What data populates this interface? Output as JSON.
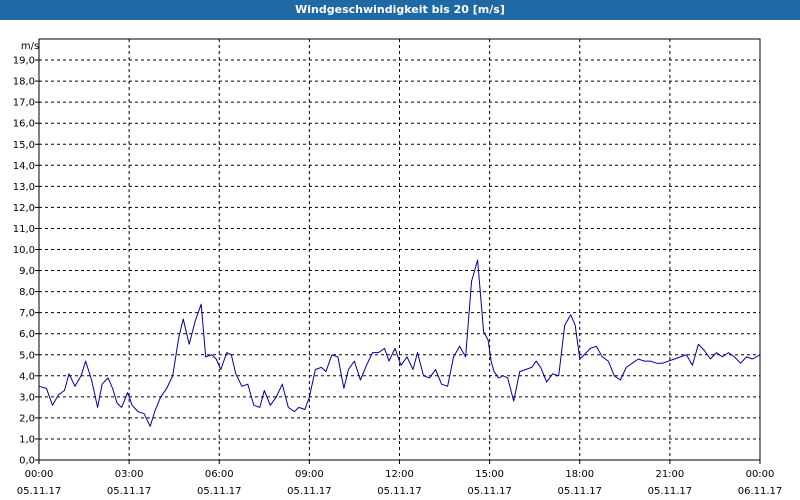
{
  "window": {
    "title": "Windgeschwindigkeit bis 20 [m/s]"
  },
  "colors": {
    "titlebar": "#1f6aa5",
    "line": "#0000aa",
    "grid": "#000000",
    "background": "#ffffff"
  },
  "chart_data": {
    "type": "line",
    "title": "Windgeschwindigkeit bis 20 [m/s]",
    "ylabel": "m/s",
    "xlabel": "",
    "ylim": [
      0,
      20
    ],
    "y_ticks": [
      "0,0",
      "1,0",
      "2,0",
      "3,0",
      "4,0",
      "5,0",
      "6,0",
      "7,0",
      "8,0",
      "9,0",
      "10,0",
      "11,0",
      "12,0",
      "13,0",
      "14,0",
      "15,0",
      "16,0",
      "17,0",
      "18,0",
      "19,0"
    ],
    "x_ticks": [
      {
        "time": "00:00",
        "date": "05.11.17"
      },
      {
        "time": "03:00",
        "date": "05.11.17"
      },
      {
        "time": "06:00",
        "date": "05.11.17"
      },
      {
        "time": "09:00",
        "date": "05.11.17"
      },
      {
        "time": "12:00",
        "date": "05.11.17"
      },
      {
        "time": "15:00",
        "date": "05.11.17"
      },
      {
        "time": "18:00",
        "date": "05.11.17"
      },
      {
        "time": "21:00",
        "date": "05.11.17"
      },
      {
        "time": "00:00",
        "date": "06.11.17"
      }
    ],
    "grid": true,
    "x_unit": "hours",
    "xlim": [
      0,
      24
    ],
    "series": [
      {
        "x": [
          0,
          0.25,
          0.45,
          0.65,
          0.85,
          1.0,
          1.2,
          1.4,
          1.55,
          1.75,
          1.95,
          2.1,
          2.3,
          2.45,
          2.6,
          2.75,
          2.95,
          3.1,
          3.3,
          3.5,
          3.7,
          3.85,
          4.05,
          4.25,
          4.45,
          4.65,
          4.8,
          5.0,
          5.2,
          5.4,
          5.55,
          5.75,
          5.9,
          6.05,
          6.25,
          6.4,
          6.55,
          6.75,
          6.95,
          7.15,
          7.35,
          7.5,
          7.7,
          7.9,
          8.1,
          8.3,
          8.5,
          8.65,
          8.85,
          9.0,
          9.2,
          9.4,
          9.55,
          9.75,
          9.95,
          10.15,
          10.3,
          10.5,
          10.7,
          10.9,
          11.1,
          11.3,
          11.5,
          11.65,
          11.85,
          12.05,
          12.25,
          12.45,
          12.6,
          12.8,
          13.0,
          13.2,
          13.4,
          13.6,
          13.8,
          14.0,
          14.2,
          14.4,
          14.6,
          14.8,
          14.95,
          15.05,
          15.15,
          15.3,
          15.45,
          15.6,
          15.8,
          16.0,
          16.2,
          16.4,
          16.55,
          16.7,
          16.9,
          17.1,
          17.3,
          17.5,
          17.7,
          17.85,
          18.0,
          18.15,
          18.35,
          18.55,
          18.75,
          18.95,
          19.15,
          19.35,
          19.55,
          19.75,
          19.95,
          20.15,
          20.35,
          20.55,
          20.75,
          20.95,
          21.15,
          21.35,
          21.55,
          21.75,
          21.95,
          22.15,
          22.35,
          22.55,
          22.75,
          22.95,
          23.15,
          23.35,
          23.55,
          23.75,
          24.0
        ],
        "values": [
          3.5,
          3.4,
          2.6,
          3.1,
          3.3,
          4.1,
          3.5,
          4.0,
          4.7,
          3.8,
          2.5,
          3.6,
          3.9,
          3.4,
          2.7,
          2.5,
          3.2,
          2.6,
          2.3,
          2.2,
          1.6,
          2.3,
          3.0,
          3.4,
          4.0,
          5.8,
          6.7,
          5.5,
          6.6,
          7.4,
          4.9,
          5.0,
          4.8,
          4.3,
          5.1,
          5.0,
          4.1,
          3.5,
          3.6,
          2.6,
          2.5,
          3.3,
          2.6,
          3.0,
          3.6,
          2.5,
          2.3,
          2.5,
          2.4,
          3.0,
          4.3,
          4.4,
          4.2,
          5.0,
          4.9,
          3.4,
          4.3,
          4.7,
          3.8,
          4.5,
          5.1,
          5.1,
          5.3,
          4.7,
          5.3,
          4.5,
          4.9,
          4.3,
          5.1,
          4.0,
          3.9,
          4.3,
          3.6,
          3.5,
          4.9,
          5.4,
          4.9,
          8.5,
          9.5,
          6.1,
          5.7,
          4.7,
          4.2,
          3.9,
          4.0,
          3.9,
          2.8,
          4.2,
          4.3,
          4.4,
          4.7,
          4.4,
          3.7,
          4.1,
          4.0,
          6.4,
          6.9,
          6.4,
          4.8,
          5.0,
          5.3,
          5.4,
          4.9,
          4.7,
          4.0,
          3.8,
          4.4,
          4.6,
          4.8,
          4.7,
          4.7,
          4.6,
          4.6,
          4.7,
          4.8,
          4.9,
          5.0,
          4.5,
          5.5,
          5.2,
          4.8,
          5.1,
          4.9,
          5.1,
          4.9,
          4.6,
          4.9,
          4.8,
          5.0
        ]
      }
    ]
  }
}
